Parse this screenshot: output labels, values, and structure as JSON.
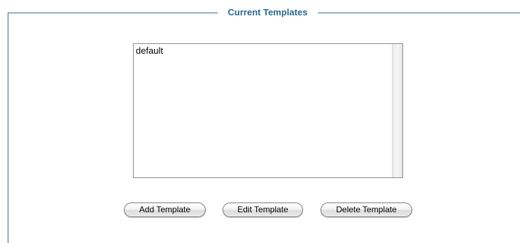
{
  "fieldset": {
    "legend": "Current Templates"
  },
  "templates_list": {
    "items": [
      "default"
    ]
  },
  "buttons": {
    "add": "Add Template",
    "edit": "Edit Template",
    "delete": "Delete Template"
  },
  "colors": {
    "legend_text": "#2b6a8e",
    "fieldset_border": "#2f6f8c"
  }
}
